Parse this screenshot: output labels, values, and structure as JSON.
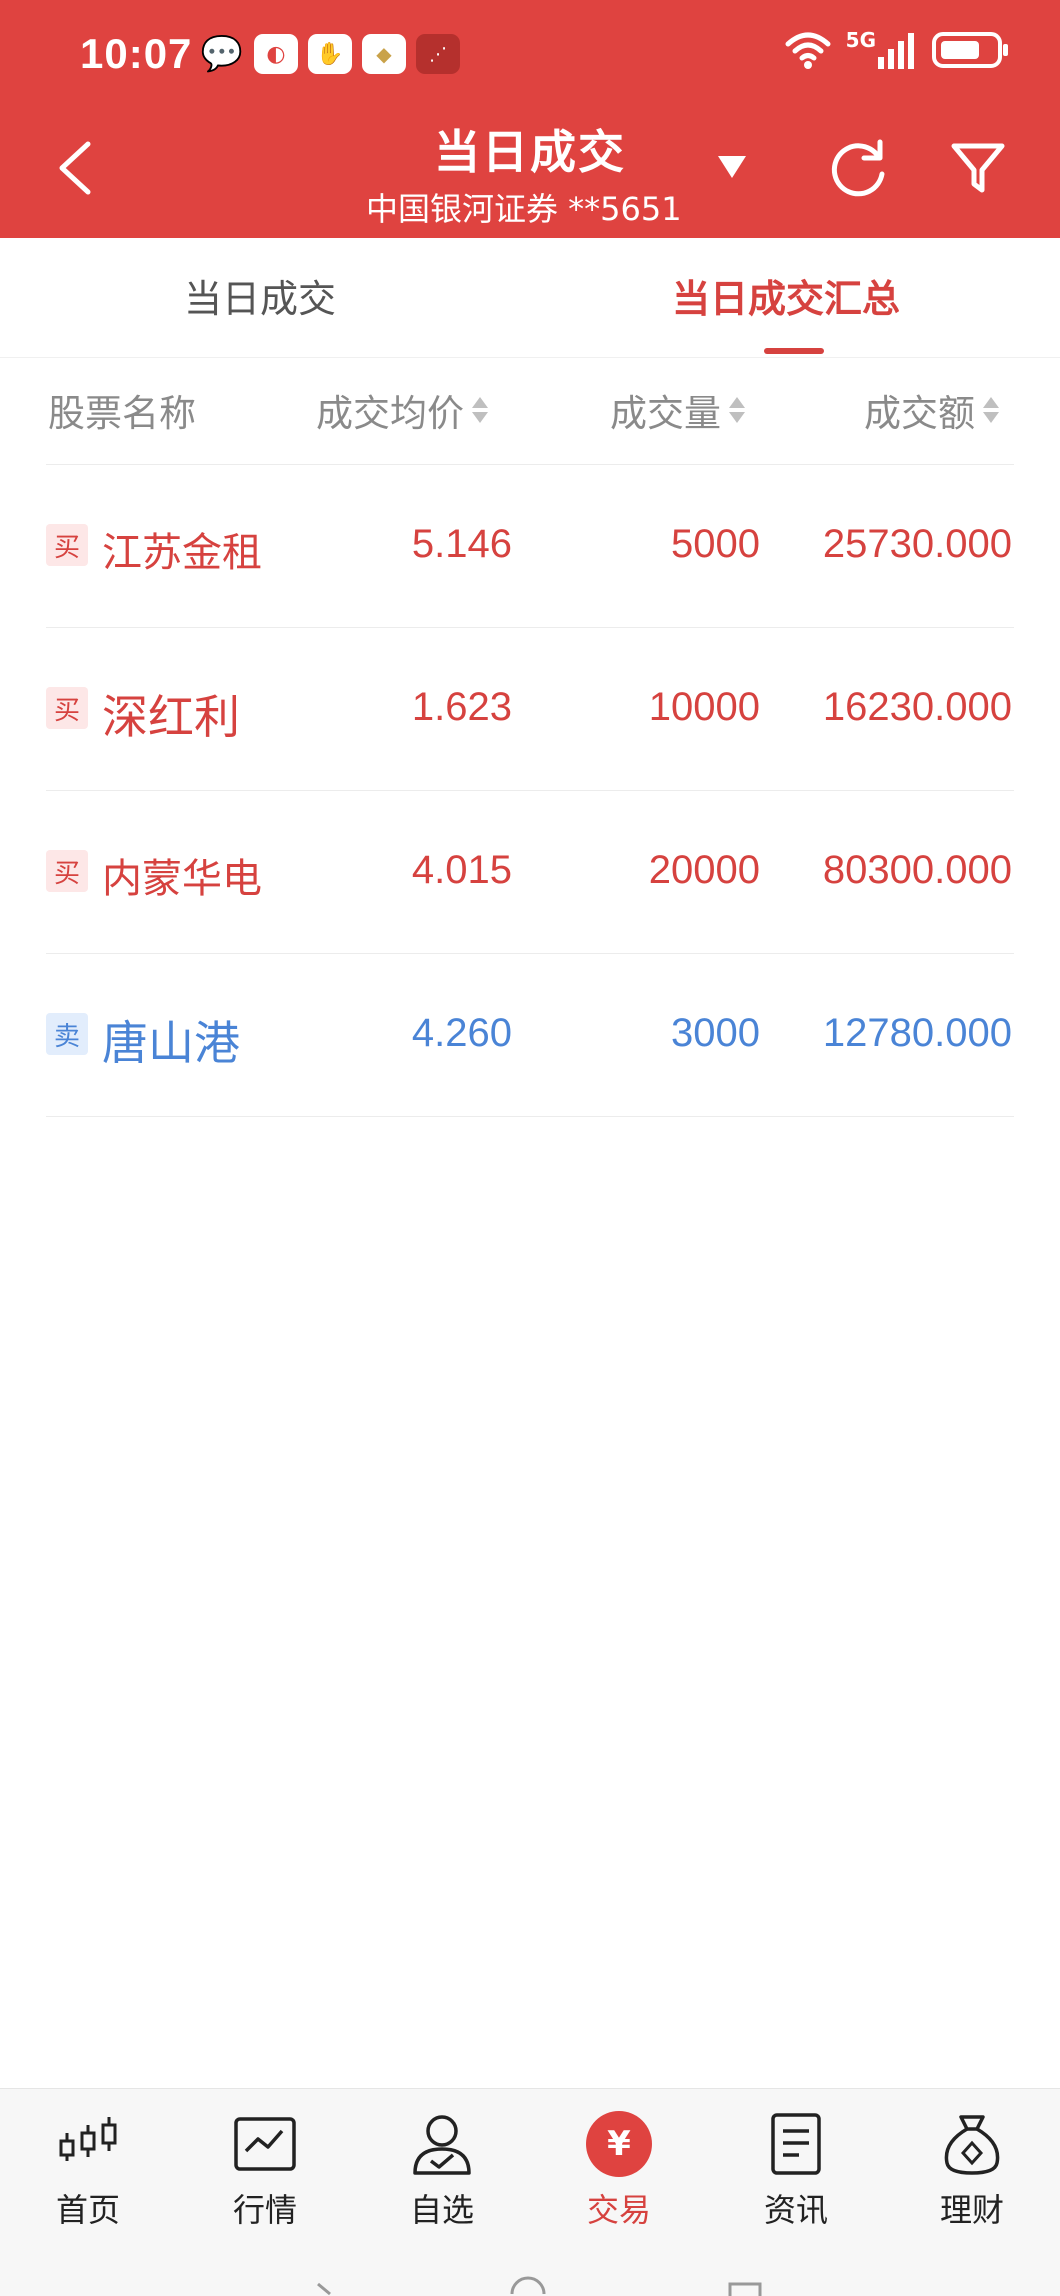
{
  "status_bar": {
    "time": "10:07",
    "network": "5G"
  },
  "header": {
    "title": "当日成交",
    "subtitle": "中国银河证券 **5651"
  },
  "tabs": [
    {
      "label": "当日成交",
      "active": false
    },
    {
      "label": "当日成交汇总",
      "active": true
    }
  ],
  "columns": [
    "股票名称",
    "成交均价",
    "成交量",
    "成交额"
  ],
  "rows": [
    {
      "side": "买",
      "name": "江苏金租",
      "avg_price": "5.146",
      "volume": "5000",
      "amount": "25730.000"
    },
    {
      "side": "买",
      "name": "深红利",
      "avg_price": "1.623",
      "volume": "10000",
      "amount": "16230.000"
    },
    {
      "side": "买",
      "name": "内蒙华电",
      "avg_price": "4.015",
      "volume": "20000",
      "amount": "80300.000"
    },
    {
      "side": "卖",
      "name": "唐山港",
      "avg_price": "4.260",
      "volume": "3000",
      "amount": "12780.000"
    }
  ],
  "bottom_nav": [
    {
      "label": "首页",
      "icon": "candlestick-icon"
    },
    {
      "label": "行情",
      "icon": "market-chart-icon"
    },
    {
      "label": "自选",
      "icon": "user-check-icon"
    },
    {
      "label": "交易",
      "icon": "yuan-icon",
      "active": true
    },
    {
      "label": "资讯",
      "icon": "document-icon"
    },
    {
      "label": "理财",
      "icon": "money-bag-icon"
    }
  ],
  "colors": {
    "header_red": "#df4340",
    "buy_red": "#d6423f",
    "sell_blue": "#4a84d6"
  }
}
